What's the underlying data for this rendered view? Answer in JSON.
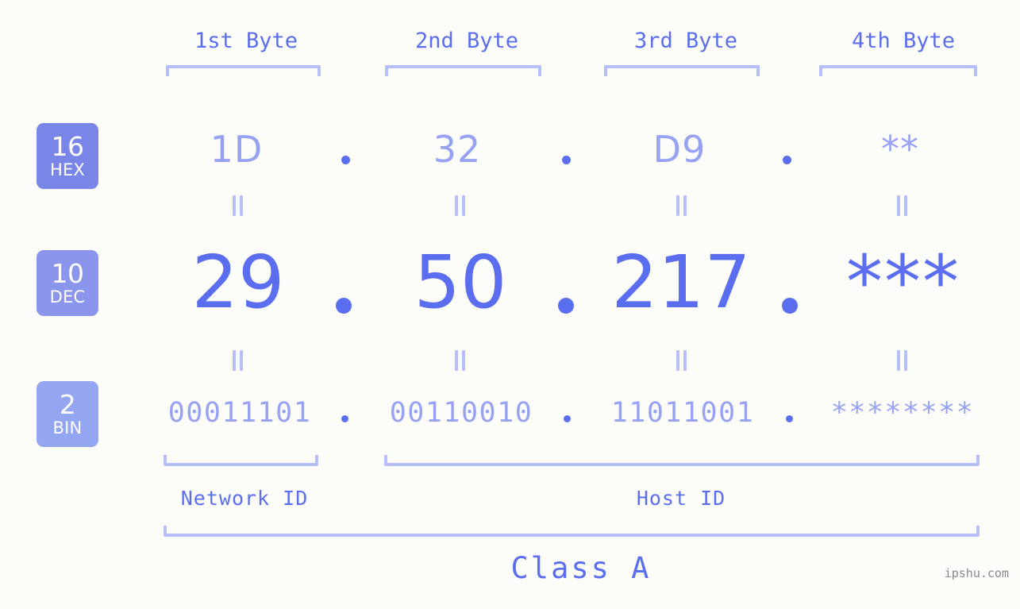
{
  "background_color": "#fcfdf9",
  "accent_colors": {
    "strong_blue": "#5b6ef0",
    "light_blue": "#97a2f2",
    "bracket_blue": "#b7bffb",
    "badge_hex": "#7986e8",
    "badge_dec": "#8b95ec",
    "badge_bin": "#94a5f1",
    "watermark_gray": "#8a8a8a"
  },
  "byte_headers": [
    {
      "label": "1st Byte"
    },
    {
      "label": "2nd Byte"
    },
    {
      "label": "3rd Byte"
    },
    {
      "label": "4th Byte"
    }
  ],
  "bases": [
    {
      "num": "16",
      "unit": "HEX"
    },
    {
      "num": "10",
      "unit": "DEC"
    },
    {
      "num": "2",
      "unit": "BIN"
    }
  ],
  "rows": {
    "hex": {
      "base_num": "16",
      "base_unit": "HEX",
      "values": [
        "1D",
        "32",
        "D9",
        "**"
      ],
      "separator": "."
    },
    "dec": {
      "base_num": "10",
      "base_unit": "DEC",
      "values": [
        "29",
        "50",
        "217",
        "***"
      ],
      "separator": "."
    },
    "bin": {
      "base_num": "2",
      "base_unit": "BIN",
      "values": [
        "00011101",
        "00110010",
        "11011001",
        "********"
      ],
      "separator": "."
    }
  },
  "equals_marker": "||",
  "segments": {
    "network_id": "Network ID",
    "host_id": "Host ID",
    "class": "Class A"
  },
  "watermark": "ipshu.com"
}
